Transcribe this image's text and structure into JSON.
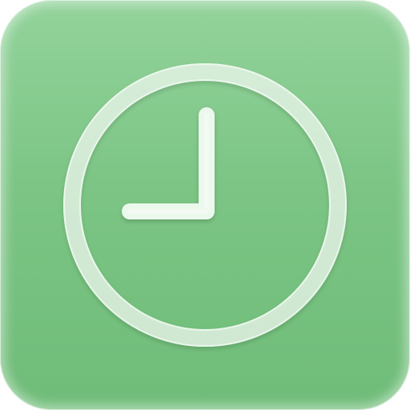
{
  "app_icon": {
    "icon": "clock-icon",
    "background_color": "#7cc585",
    "glyph_color": "#eef9ef"
  }
}
